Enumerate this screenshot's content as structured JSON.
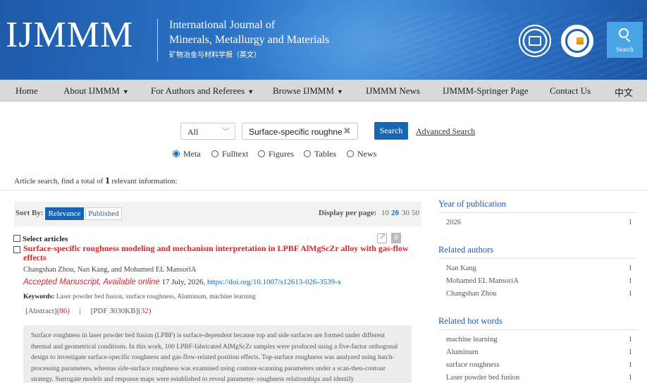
{
  "header": {
    "logo_text": "IJMMM",
    "journal_name_lines": [
      "International Journal of",
      "Minerals, Metallurgy and Materials"
    ],
    "journal_name_cn": "矿物冶金与材料学报（英文）",
    "search_tile_label": "Search"
  },
  "nav": {
    "items": [
      {
        "label": "Home",
        "has_caret": false
      },
      {
        "label": "About IJMMM",
        "has_caret": true
      },
      {
        "label": "For Authors and Referees",
        "has_caret": true
      },
      {
        "label": "Browse IJMMM",
        "has_caret": true
      },
      {
        "label": "IJMMM News",
        "has_caret": false
      },
      {
        "label": "IJMMM-Springer Page",
        "has_caret": false
      },
      {
        "label": "Contact Us",
        "has_caret": false
      },
      {
        "label": "中文",
        "has_caret": false
      }
    ],
    "caret_glyph": "▼"
  },
  "search": {
    "scope_value": "All",
    "query_value": "Surface-specific roughness modeling",
    "clear_glyph": "✖",
    "button_label": "Search",
    "advanced_label": "Advanced Search",
    "types": [
      {
        "label": "Meta",
        "selected": true
      },
      {
        "label": "Fulltext",
        "selected": false
      },
      {
        "label": "Figures",
        "selected": false
      },
      {
        "label": "Tables",
        "selected": false
      },
      {
        "label": "News",
        "selected": false
      }
    ]
  },
  "results": {
    "summary_prefix": "Article search, find a total of ",
    "count": "1",
    "summary_suffix": " relevant information:"
  },
  "sort": {
    "label": "Sort By:",
    "options": [
      "Relevance",
      "Published"
    ],
    "active": "Relevance",
    "per_page_label": "Display per page:",
    "per_page_options": [
      "10",
      "20",
      "30",
      "50"
    ],
    "per_page_active": "20"
  },
  "article_list": {
    "select_all_label": "Select articles",
    "r_icon_glyph": "R",
    "article": {
      "title": "Surface-specific roughness modeling and mechanism interpretation in LPBF AlMgScZr alloy with gas-flow effects",
      "authors": "Changshan Zhou, Nan Kang, and Mohamed EL MansoriA",
      "status": "Accepted Manuscript, Available online",
      "date": " 17 July, 2026, ",
      "doi": "https://doi.org/10.1007/s12613-026-3539-x",
      "keywords_label": "Keywords:",
      "keywords": " Laser powder bed fusion, surface roughness, Aluminum, machine learning",
      "abstract_label": "[Abstract]",
      "abstract_count": "(86)",
      "separator": "|",
      "pdf_label": "[PDF 3030KB]",
      "pdf_count": "(32)",
      "abstract": "Surface roughness in laser powder bed fusion (LPBF) is surface-dependent because top and side surfaces are formed under different thermal and geometrical conditions. In this work, 100 LPBF-fabricated AlMgScZr samples were produced using a five-factor orthogonal design to investigate surface-specific roughness and gas-flow-related position effects. Top-surface roughness was analyzed using hatch-processing parameters, whereas side-surface roughness was examined using contour-scanning parameters under a scan-then-contour strategy. Surrogate models and response maps were established to reveal parameter–roughness relationships and identify"
    }
  },
  "facets": [
    {
      "title": "Year of publication",
      "rows": [
        {
          "label": "2026",
          "count": "1"
        }
      ]
    },
    {
      "title": "Related authors",
      "rows": [
        {
          "label": "Nan Kang",
          "count": "1"
        },
        {
          "label": "Mohamed EL MansoriA",
          "count": "1"
        },
        {
          "label": "Changshan Zhou",
          "count": "1"
        }
      ]
    },
    {
      "title": "Related hot words",
      "rows": [
        {
          "label": "machine learning",
          "count": "1"
        },
        {
          "label": "Aluminum",
          "count": "1"
        },
        {
          "label": "surface roughness",
          "count": "1"
        },
        {
          "label": "Laser powder bed fusion",
          "count": "1"
        }
      ]
    }
  ],
  "colors": {
    "brand_blue": "#1766b5",
    "title_red": "#e0202a",
    "nav_gray": "#d9d9d9",
    "facet_blue": "#1d5aa8"
  },
  "icons": [
    "search-icon",
    "chevron-down-icon",
    "clear-icon",
    "share-icon",
    "reference-icon",
    "society-emblem-icon",
    "itm-emblem-icon"
  ]
}
